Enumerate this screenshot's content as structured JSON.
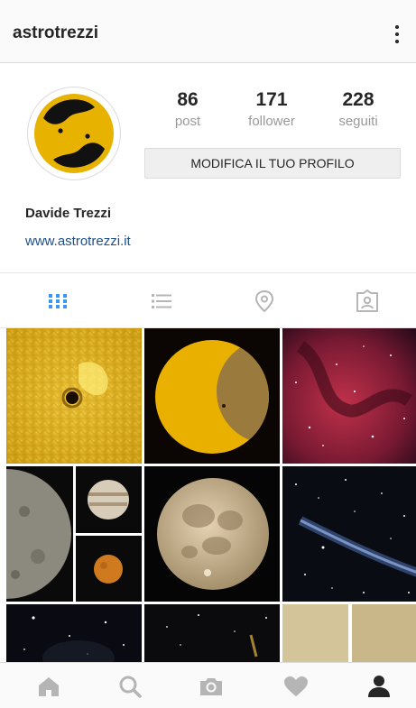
{
  "header": {
    "username": "astrotrezzi",
    "menu_icon": "more-vertical-icon"
  },
  "profile": {
    "stats": [
      {
        "value": "86",
        "label": "post"
      },
      {
        "value": "171",
        "label": "follower"
      },
      {
        "value": "228",
        "label": "seguiti"
      }
    ],
    "edit_button": "MODIFICA IL TUO PROFILO",
    "full_name": "Davide Trezzi",
    "website": "www.astrotrezzi.it",
    "avatar_colors": [
      "#e8b200",
      "#111111"
    ]
  },
  "tabs": [
    {
      "icon": "grid-icon",
      "active": true
    },
    {
      "icon": "list-icon",
      "active": false
    },
    {
      "icon": "location-pin-icon",
      "active": false
    },
    {
      "icon": "tagged-person-icon",
      "active": false
    }
  ],
  "bottom_nav": [
    {
      "icon": "home-icon",
      "active": false
    },
    {
      "icon": "search-icon",
      "active": false
    },
    {
      "icon": "camera-icon",
      "active": false
    },
    {
      "icon": "heart-icon",
      "active": false
    },
    {
      "icon": "profile-icon",
      "active": true
    }
  ],
  "colors": {
    "accent": "#3897f0",
    "link": "#1c4f8c",
    "inactive": "#b5b5b5"
  }
}
